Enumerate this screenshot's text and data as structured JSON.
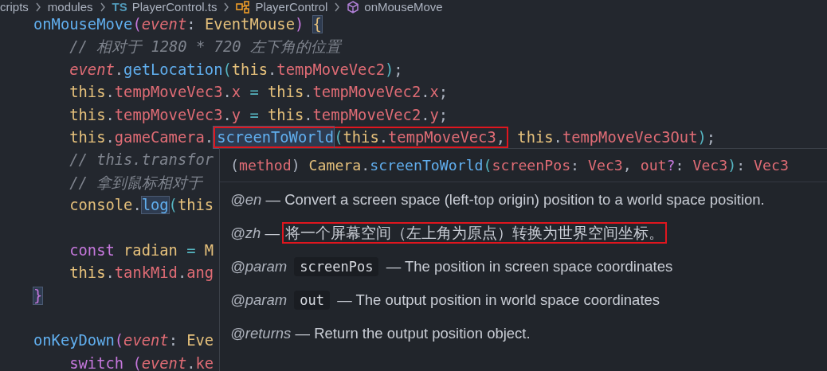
{
  "breadcrumb": [
    {
      "kind": "text",
      "label": "cripts"
    },
    {
      "kind": "text",
      "label": "modules"
    },
    {
      "kind": "ts",
      "label": "TS",
      "text": "PlayerControl.ts"
    },
    {
      "kind": "class",
      "label": "PlayerControl"
    },
    {
      "kind": "method",
      "label": "onMouseMove"
    }
  ],
  "code_lines": [
    {
      "kind": "code",
      "indent": false,
      "tokens": [
        {
          "kind": "fn",
          "t": "onMouseMove"
        },
        {
          "kind": "paren",
          "t": "("
        },
        {
          "kind": "param",
          "t": "event"
        },
        {
          "kind": "punct",
          "t": ": "
        },
        {
          "kind": "type",
          "t": "EventMouse"
        },
        {
          "kind": "paren",
          "t": ") "
        },
        {
          "kind": "brace",
          "t": "{",
          "marked": true
        }
      ]
    },
    {
      "kind": "code",
      "indent": true,
      "tokens": [
        {
          "kind": "comment",
          "t": "// 相对于 1280 * 720 左下角的位置"
        }
      ]
    },
    {
      "kind": "code",
      "indent": true,
      "tokens": [
        {
          "kind": "param",
          "t": "event"
        },
        {
          "kind": "punct",
          "t": "."
        },
        {
          "kind": "fn",
          "t": "getLocation"
        },
        {
          "kind": "paren2",
          "t": "("
        },
        {
          "kind": "this",
          "t": "this"
        },
        {
          "kind": "punct",
          "t": "."
        },
        {
          "kind": "prop",
          "t": "tempMoveVec2"
        },
        {
          "kind": "paren2",
          "t": ")"
        },
        {
          "kind": "punct",
          "t": ";"
        }
      ]
    },
    {
      "kind": "code",
      "indent": true,
      "tokens": [
        {
          "kind": "this",
          "t": "this"
        },
        {
          "kind": "punct",
          "t": "."
        },
        {
          "kind": "prop",
          "t": "tempMoveVec3"
        },
        {
          "kind": "punct",
          "t": "."
        },
        {
          "kind": "prop",
          "t": "x"
        },
        {
          "kind": "op",
          "t": " = "
        },
        {
          "kind": "this",
          "t": "this"
        },
        {
          "kind": "punct",
          "t": "."
        },
        {
          "kind": "prop",
          "t": "tempMoveVec2"
        },
        {
          "kind": "punct",
          "t": "."
        },
        {
          "kind": "prop",
          "t": "x"
        },
        {
          "kind": "punct",
          "t": ";"
        }
      ]
    },
    {
      "kind": "code",
      "indent": true,
      "tokens": [
        {
          "kind": "this",
          "t": "this"
        },
        {
          "kind": "punct",
          "t": "."
        },
        {
          "kind": "prop",
          "t": "tempMoveVec3"
        },
        {
          "kind": "punct",
          "t": "."
        },
        {
          "kind": "prop",
          "t": "y"
        },
        {
          "kind": "op",
          "t": " = "
        },
        {
          "kind": "this",
          "t": "this"
        },
        {
          "kind": "punct",
          "t": "."
        },
        {
          "kind": "prop",
          "t": "tempMoveVec2"
        },
        {
          "kind": "punct",
          "t": "."
        },
        {
          "kind": "prop",
          "t": "y"
        },
        {
          "kind": "punct",
          "t": ";"
        }
      ]
    },
    {
      "kind": "code",
      "indent": true,
      "tokens": [
        {
          "kind": "this",
          "t": "this"
        },
        {
          "kind": "punct",
          "t": "."
        },
        {
          "kind": "prop",
          "t": "gameCamera"
        },
        {
          "kind": "punct",
          "t": "."
        },
        {
          "kind": "fn",
          "t": "screenToWorld",
          "marked": true,
          "boxed": true
        },
        {
          "kind": "paren2",
          "t": "(",
          "boxed": true
        },
        {
          "kind": "this",
          "t": "this",
          "boxed": true
        },
        {
          "kind": "punct",
          "t": ".",
          "boxed": true
        },
        {
          "kind": "prop",
          "t": "tempMoveVec3",
          "boxed": true
        },
        {
          "kind": "punct",
          "t": ",",
          "boxed": true
        },
        {
          "kind": "this",
          "t": " this"
        },
        {
          "kind": "punct",
          "t": "."
        },
        {
          "kind": "prop",
          "t": "tempMoveVec3Out"
        },
        {
          "kind": "paren2",
          "t": ")"
        },
        {
          "kind": "punct",
          "t": ";"
        }
      ]
    },
    {
      "kind": "code",
      "indent": true,
      "tokens": [
        {
          "kind": "comment",
          "t": "// this.transfor"
        }
      ]
    },
    {
      "kind": "code",
      "indent": true,
      "tokens": [
        {
          "kind": "comment",
          "t": "// 拿到鼠标相对于"
        }
      ]
    },
    {
      "kind": "code",
      "indent": true,
      "tokens": [
        {
          "kind": "type",
          "t": "console"
        },
        {
          "kind": "punct",
          "t": "."
        },
        {
          "kind": "fn",
          "t": "log",
          "marked": true
        },
        {
          "kind": "paren2",
          "t": "("
        },
        {
          "kind": "this",
          "t": "this"
        }
      ]
    },
    {
      "kind": "blank"
    },
    {
      "kind": "code",
      "indent": true,
      "tokens": [
        {
          "kind": "kw",
          "t": "const "
        },
        {
          "kind": "type",
          "t": "radian"
        },
        {
          "kind": "op",
          "t": " = "
        },
        {
          "kind": "type",
          "t": "M"
        }
      ]
    },
    {
      "kind": "code",
      "indent": true,
      "tokens": [
        {
          "kind": "this",
          "t": "this"
        },
        {
          "kind": "punct",
          "t": "."
        },
        {
          "kind": "prop",
          "t": "tankMid"
        },
        {
          "kind": "punct",
          "t": "."
        },
        {
          "kind": "prop",
          "t": "ang"
        }
      ]
    },
    {
      "kind": "code",
      "indent": false,
      "tokens": [
        {
          "kind": "paren",
          "t": "}",
          "marked": true
        }
      ]
    },
    {
      "kind": "blank"
    },
    {
      "kind": "code",
      "indent": false,
      "tokens": [
        {
          "kind": "fn",
          "t": "onKeyDown"
        },
        {
          "kind": "paren",
          "t": "("
        },
        {
          "kind": "param",
          "t": "event"
        },
        {
          "kind": "punct",
          "t": ": "
        },
        {
          "kind": "type",
          "t": "Eve"
        }
      ]
    },
    {
      "kind": "code",
      "indent": true,
      "tokens": [
        {
          "kind": "kw",
          "t": "switch "
        },
        {
          "kind": "paren",
          "t": "("
        },
        {
          "kind": "param",
          "t": "event"
        },
        {
          "kind": "punct",
          "t": "."
        },
        {
          "kind": "prop",
          "t": "ke"
        }
      ]
    }
  ],
  "hover": {
    "signature": [
      {
        "kind": "punct",
        "t": "("
      },
      {
        "kind": "prop",
        "t": "method"
      },
      {
        "kind": "punct",
        "t": ") "
      },
      {
        "kind": "type",
        "t": "Camera"
      },
      {
        "kind": "punct",
        "t": "."
      },
      {
        "kind": "fn",
        "t": "screenToWorld"
      },
      {
        "kind": "paren2",
        "t": "("
      },
      {
        "kind": "prop",
        "t": "screenPos"
      },
      {
        "kind": "punct",
        "t": ": "
      },
      {
        "kind": "prop",
        "t": "Vec3"
      },
      {
        "kind": "punct",
        "t": ", "
      },
      {
        "kind": "prop",
        "t": "out"
      },
      {
        "kind": "kw",
        "t": "?"
      },
      {
        "kind": "punct",
        "t": ": "
      },
      {
        "kind": "prop",
        "t": "Vec3"
      },
      {
        "kind": "paren2",
        "t": ")"
      },
      {
        "kind": "punct",
        "t": ": "
      },
      {
        "kind": "prop",
        "t": "Vec3"
      }
    ],
    "docs": [
      {
        "tag": "@en",
        "dash": "—",
        "text": "Convert a screen space (left-top origin) position to a world space position.",
        "boxed": false
      },
      {
        "tag": "@zh",
        "dash": "—",
        "text": "将一个屏幕空间（左上角为原点）转换为世界空间坐标。",
        "boxed": true
      },
      {
        "tag": "@param",
        "code": "screenPos",
        "dash": "—",
        "text": "The position in screen space coordinates",
        "boxed": false
      },
      {
        "tag": "@param",
        "code": "out",
        "dash": "—",
        "text": "The output position in world space coordinates",
        "boxed": false
      },
      {
        "tag": "@returns",
        "dash": "—",
        "text": "Return the output position object.",
        "boxed": false
      }
    ]
  }
}
